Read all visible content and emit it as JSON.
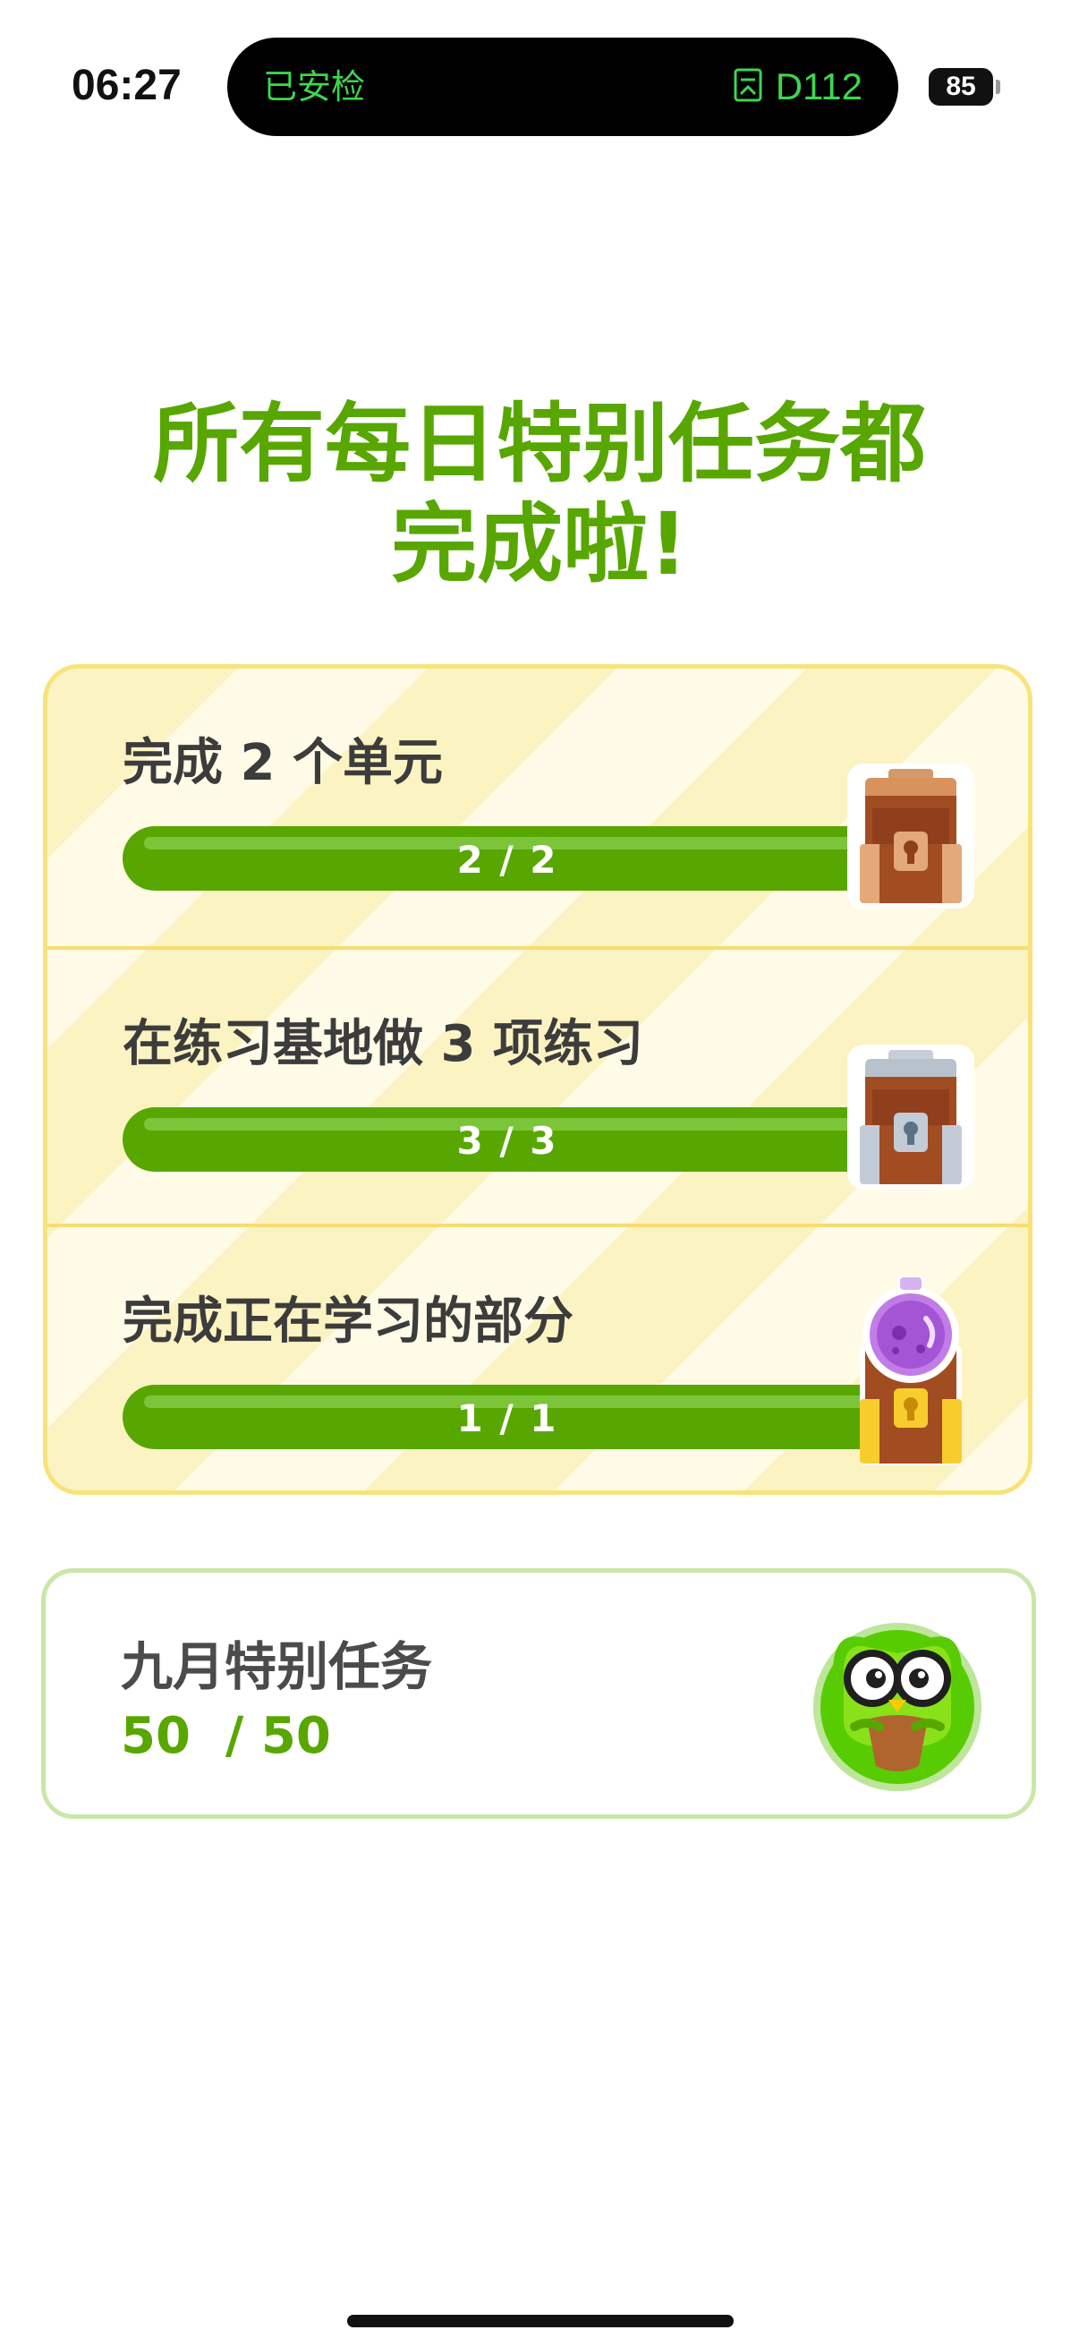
{
  "status_bar": {
    "time": "06:27",
    "island_left": "已安检",
    "island_right_icon": "ticket-icon",
    "island_right": "D112",
    "battery": "85"
  },
  "headline": {
    "line1": "所有每日特别任务都",
    "line2": "完成啦!"
  },
  "colors": {
    "accent_green": "#58a700",
    "card_border_yellow": "#f8e37b",
    "monthly_border_green": "#c9e7a8"
  },
  "quests": [
    {
      "title": "完成 2 个单元",
      "progress_text": "2 / 2",
      "progress": 1.0,
      "icon": "chest-bronze-icon"
    },
    {
      "title": "在练习基地做 3 项练习",
      "progress_text": "3 / 3",
      "progress": 1.0,
      "icon": "chest-silver-icon"
    },
    {
      "title": "完成正在学习的部分",
      "progress_text": "1 / 1",
      "progress": 1.0,
      "icon": "chest-gold-potion-icon"
    }
  ],
  "monthly": {
    "title": "九月特别任务",
    "progress_text": "50  / 50",
    "icon": "owl-mascot-icon"
  }
}
